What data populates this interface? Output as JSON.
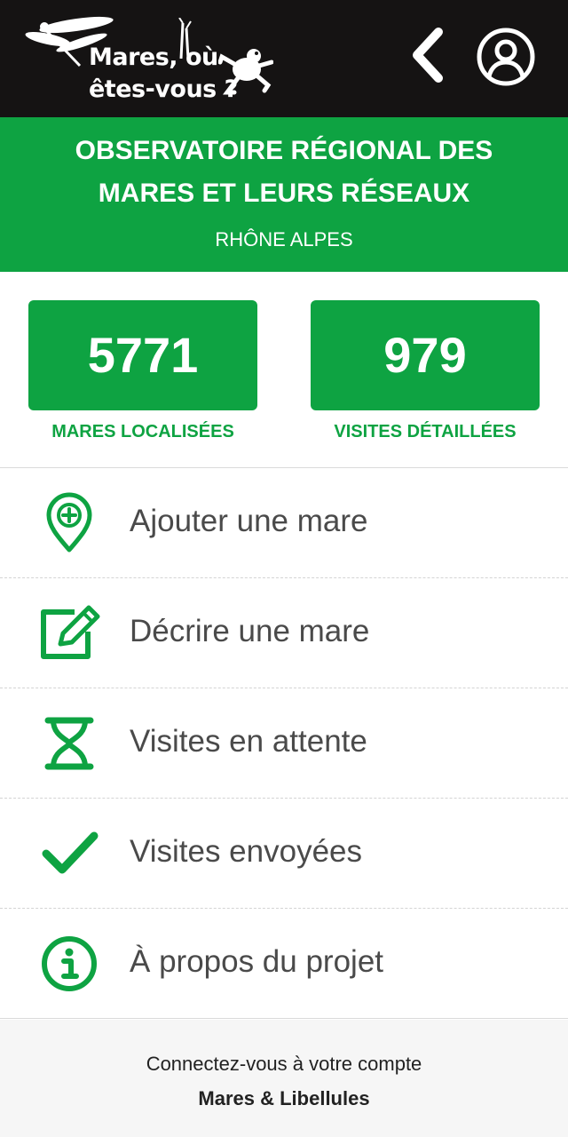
{
  "topbar": {
    "logo": {
      "line1": "Mares, où",
      "line2": "êtes-vous ?",
      "icon_left": "dragonfly-icon",
      "icon_right": "frog-icon"
    },
    "back_icon": "chevron-left-icon",
    "account_icon": "account-icon"
  },
  "header": {
    "title_line1": "OBSERVATOIRE RÉGIONAL DES",
    "title_line2": "MARES ET LEURS RÉSEAUX",
    "region": "RHÔNE ALPES"
  },
  "stats": [
    {
      "value": "5771",
      "label": "MARES LOCALISÉES"
    },
    {
      "value": "979",
      "label": "VISITES DÉTAILLÉES"
    }
  ],
  "menu": {
    "items": [
      {
        "label": "Ajouter une mare",
        "icon": "map-pin-plus-icon"
      },
      {
        "label": "Décrire une mare",
        "icon": "edit-icon"
      },
      {
        "label": "Visites en attente",
        "icon": "hourglass-icon"
      },
      {
        "label": "Visites envoyées",
        "icon": "check-icon"
      },
      {
        "label": "À propos du projet",
        "icon": "info-icon"
      }
    ]
  },
  "footer": {
    "line1": "Connectez-vous à votre compte",
    "line2": "Mares & Libellules"
  },
  "colors": {
    "topbar": "#151313",
    "accent": "#0ea342",
    "text": "#4a4a4a",
    "footer_bg": "#f6f6f6"
  }
}
